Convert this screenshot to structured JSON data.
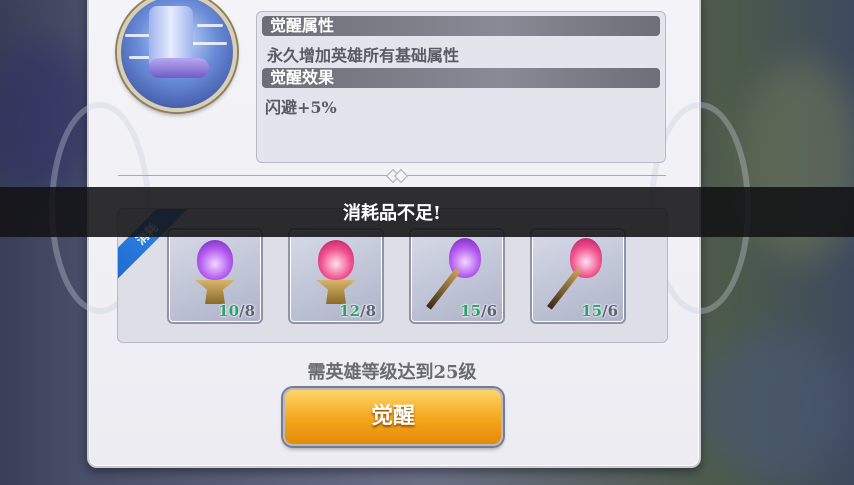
{
  "awaken_panel": {
    "attribute_header": "觉醒属性",
    "attribute_text": "永久增加英雄所有基础属性",
    "effect_header": "觉醒效果",
    "effect_text": "闪避+5%"
  },
  "cost": {
    "ribbon_label": "消耗",
    "items": [
      {
        "icon": "purple-flame-brazier-icon",
        "owned": "10",
        "required": "8"
      },
      {
        "icon": "pink-flame-brazier-icon",
        "owned": "12",
        "required": "8"
      },
      {
        "icon": "purple-flame-torch-icon",
        "owned": "15",
        "required": "6"
      },
      {
        "icon": "pink-flame-torch-icon",
        "owned": "15",
        "required": "6"
      }
    ]
  },
  "requirement_text": "需英雄等级达到25级",
  "awaken_button_label": "觉醒",
  "toast_message": "消耗品不足!",
  "colors": {
    "accent": "#f4a51a",
    "count_ok": "#2aa36a",
    "ribbon": "#2a7fe6"
  }
}
